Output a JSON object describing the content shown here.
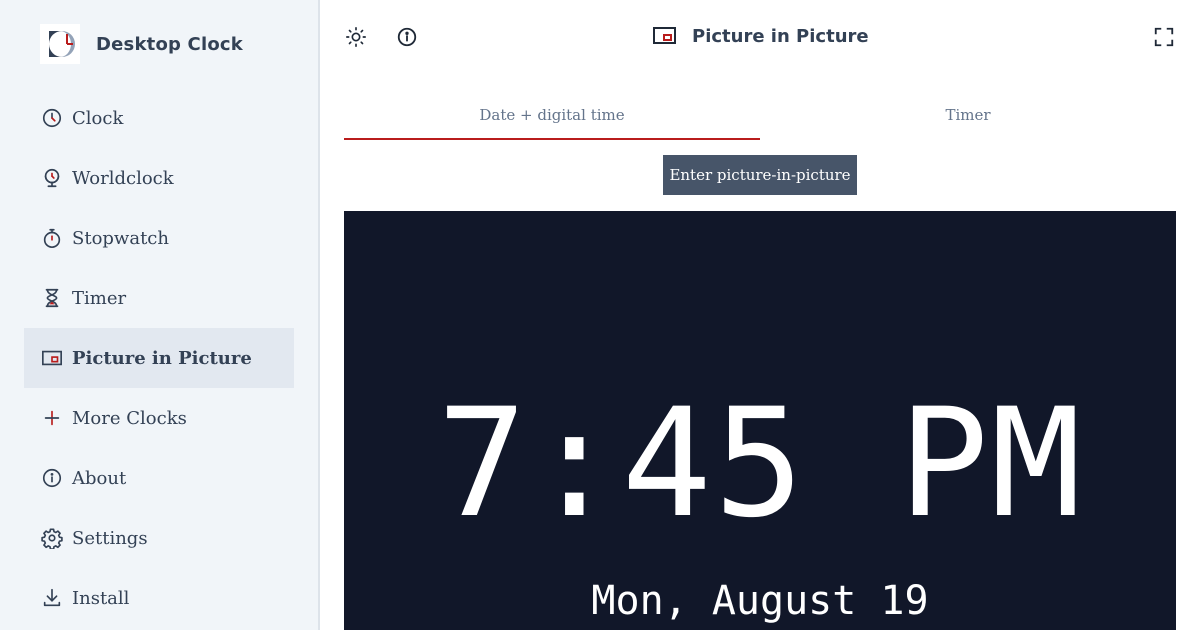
{
  "app": {
    "name": "Desktop Clock"
  },
  "sidebar": {
    "items": [
      {
        "label": "Clock",
        "icon": "clock-icon"
      },
      {
        "label": "Worldclock",
        "icon": "globe-clock-icon"
      },
      {
        "label": "Stopwatch",
        "icon": "stopwatch-icon"
      },
      {
        "label": "Timer",
        "icon": "hourglass-icon"
      },
      {
        "label": "Picture in Picture",
        "icon": "picture-in-picture-icon",
        "active": true
      },
      {
        "label": "More Clocks",
        "icon": "plus-icon"
      },
      {
        "label": "About",
        "icon": "info-icon"
      },
      {
        "label": "Settings",
        "icon": "gear-icon"
      },
      {
        "label": "Install",
        "icon": "download-icon"
      }
    ]
  },
  "header": {
    "title": "Picture in Picture",
    "left_icons": [
      "sun-icon",
      "info-icon"
    ],
    "right_icons": [
      "fullscreen-icon"
    ]
  },
  "tabs": [
    {
      "label": "Date + digital time",
      "active": true
    },
    {
      "label": "Timer",
      "active": false
    }
  ],
  "pip_button": {
    "label": "Enter picture-in-picture"
  },
  "preview": {
    "time": "7:45 PM",
    "date": "Mon, August 19"
  },
  "colors": {
    "accent": "#b91c1c",
    "sidebar_bg": "#f1f5f9",
    "sidebar_active": "#e2e8f0",
    "text": "#334155",
    "button_bg": "#475569",
    "preview_bg": "#111729"
  }
}
